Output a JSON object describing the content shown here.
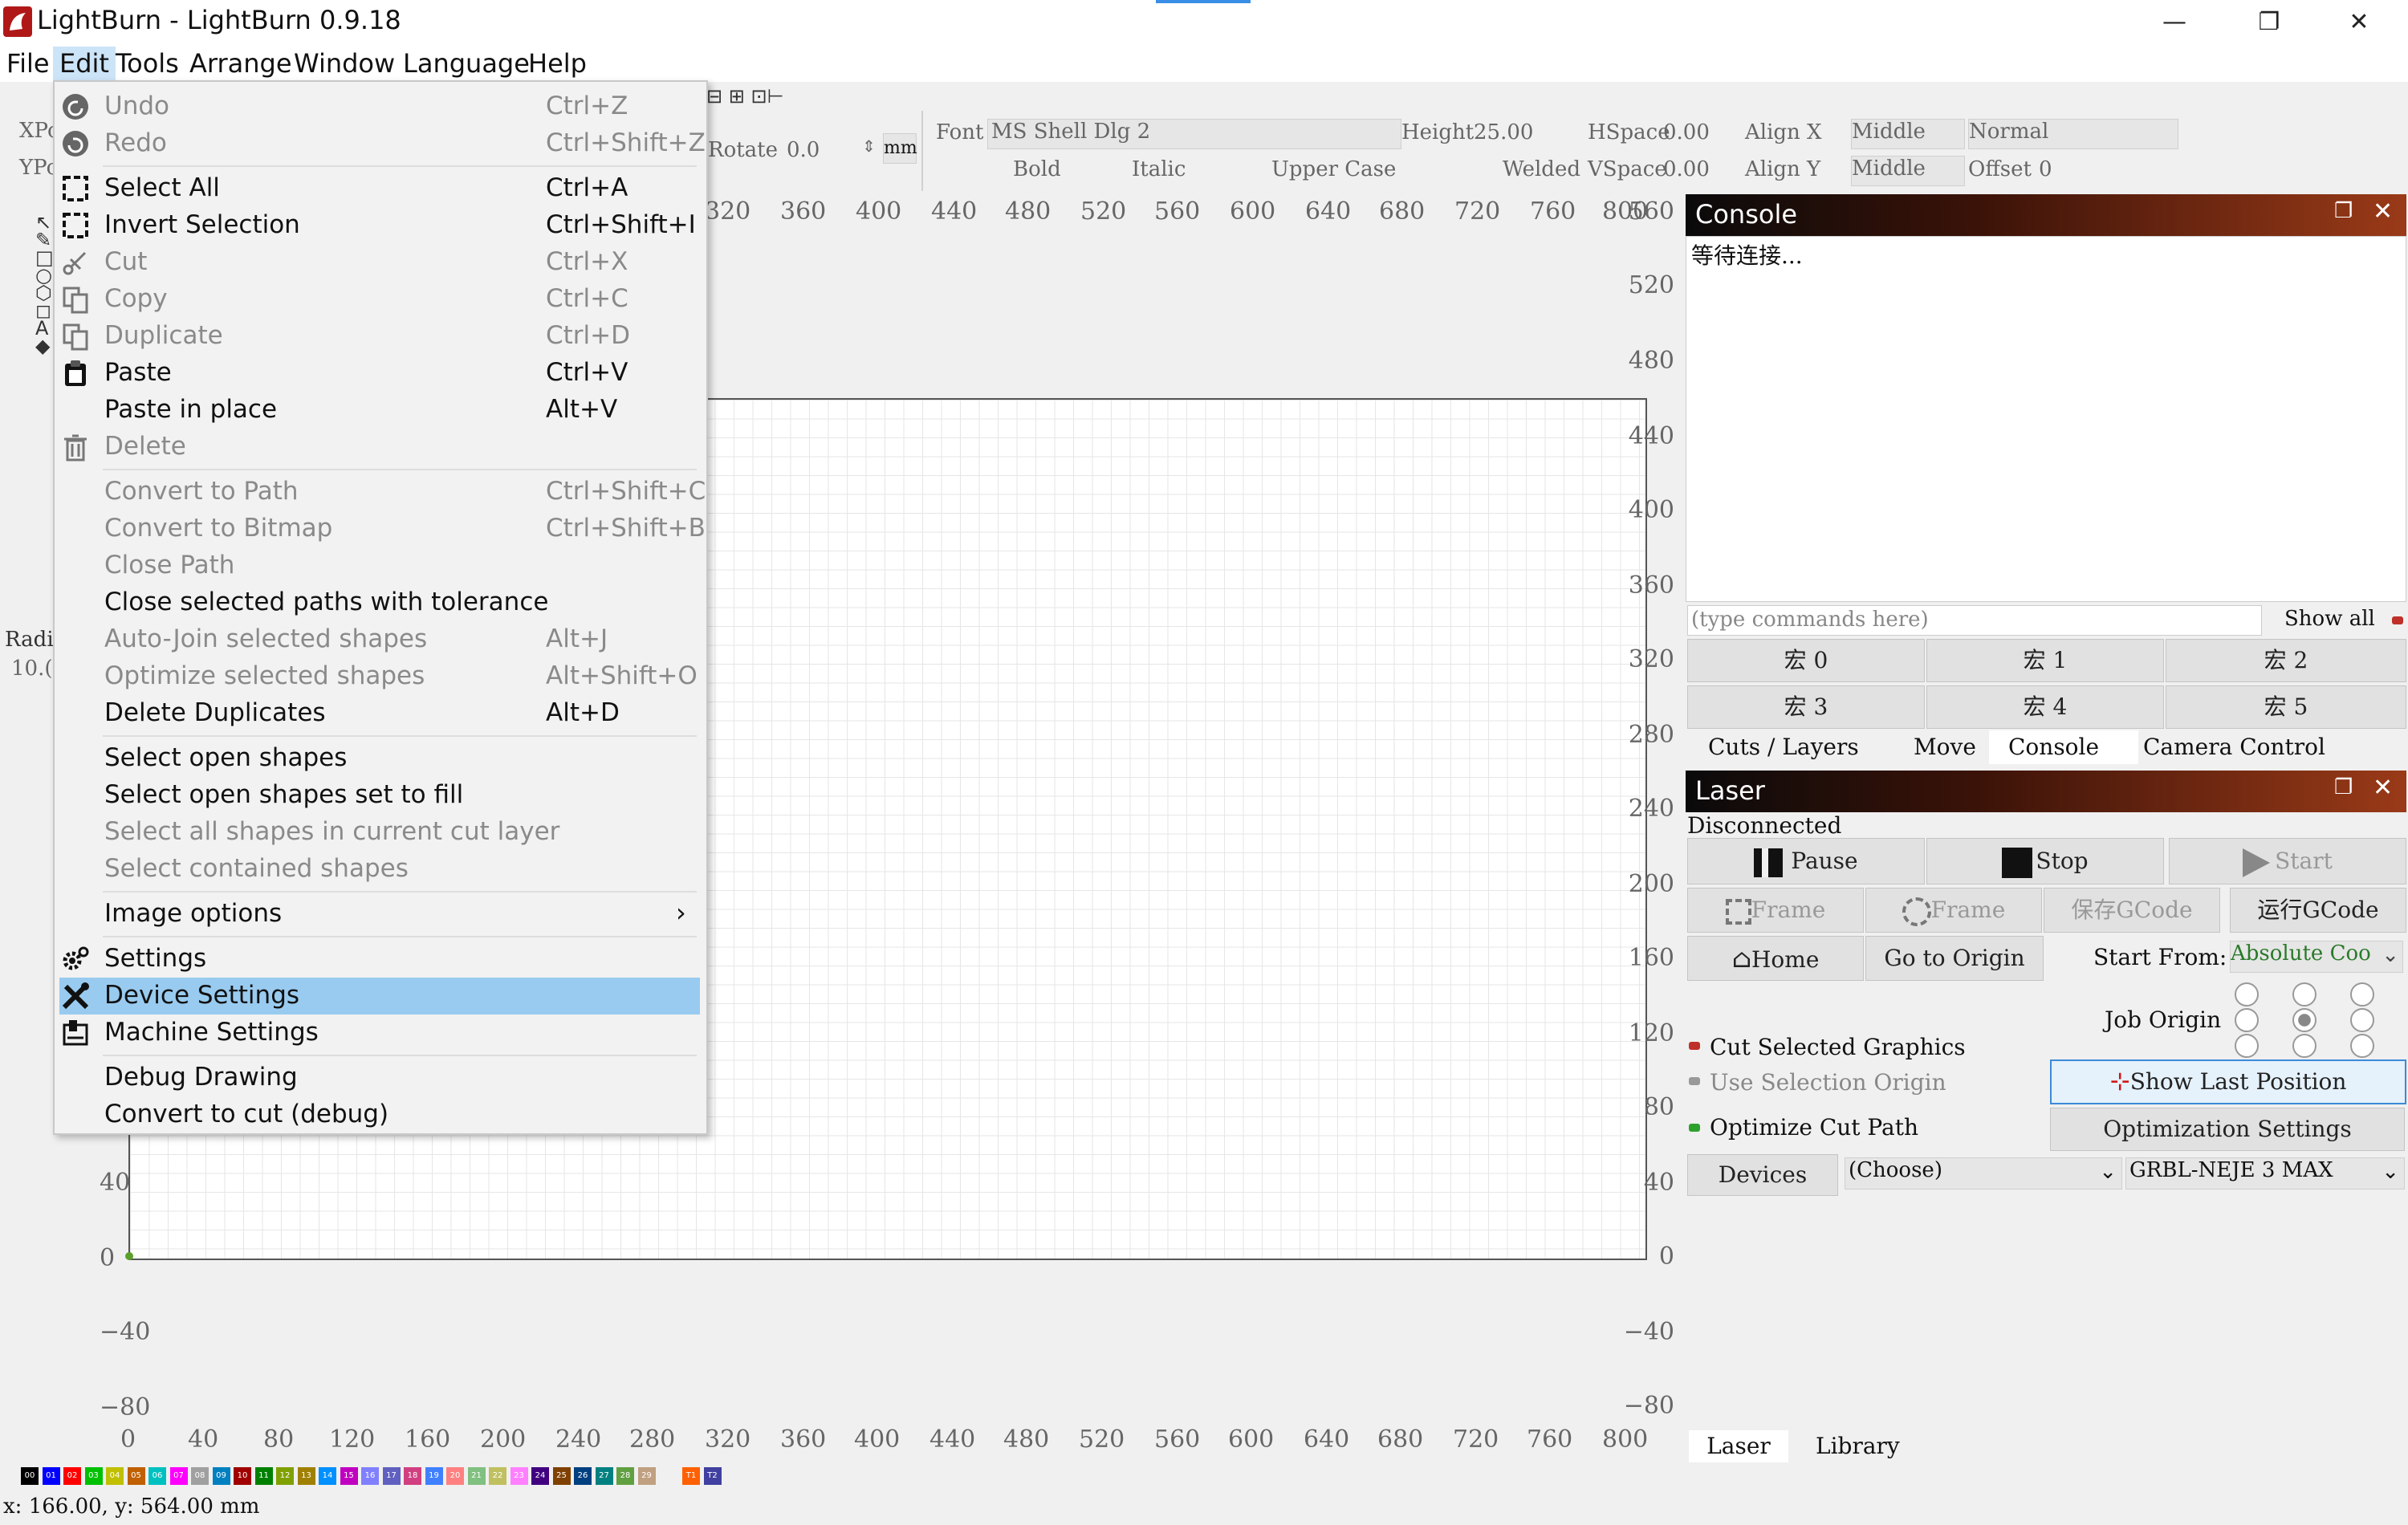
{
  "window": {
    "title": "LightBurn - LightBurn 0.9.18",
    "minimize": "—",
    "maximize": "❐",
    "close": "✕"
  },
  "menubar": [
    "File",
    "Edit",
    "Tools",
    "Arrange",
    "Window",
    "Language",
    "Help"
  ],
  "edit_menu": [
    {
      "label": "Undo",
      "shortcut": "Ctrl+Z",
      "disabled": true,
      "icon": "undo-icon"
    },
    {
      "label": "Redo",
      "shortcut": "Ctrl+Shift+Z",
      "disabled": true,
      "icon": "redo-icon"
    },
    {
      "label": "Select All",
      "shortcut": "Ctrl+A",
      "disabled": false,
      "icon": "select-all-icon"
    },
    {
      "label": "Invert Selection",
      "shortcut": "Ctrl+Shift+I",
      "disabled": false,
      "icon": "invert-selection-icon"
    },
    {
      "label": "Cut",
      "shortcut": "Ctrl+X",
      "disabled": true,
      "icon": "scissors-icon"
    },
    {
      "label": "Copy",
      "shortcut": "Ctrl+C",
      "disabled": true,
      "icon": "copy-icon"
    },
    {
      "label": "Duplicate",
      "shortcut": "Ctrl+D",
      "disabled": true,
      "icon": "duplicate-icon"
    },
    {
      "label": "Paste",
      "shortcut": "Ctrl+V",
      "disabled": false,
      "icon": "clipboard-icon"
    },
    {
      "label": "Paste in place",
      "shortcut": "Alt+V",
      "disabled": false,
      "icon": ""
    },
    {
      "label": "Delete",
      "shortcut": "",
      "disabled": true,
      "icon": "trash-icon"
    },
    {
      "label": "Convert to Path",
      "shortcut": "Ctrl+Shift+C",
      "disabled": true,
      "icon": ""
    },
    {
      "label": "Convert to Bitmap",
      "shortcut": "Ctrl+Shift+B",
      "disabled": true,
      "icon": ""
    },
    {
      "label": "Close Path",
      "shortcut": "",
      "disabled": true,
      "icon": ""
    },
    {
      "label": "Close selected paths with tolerance",
      "shortcut": "",
      "disabled": false,
      "icon": ""
    },
    {
      "label": "Auto-Join selected shapes",
      "shortcut": "Alt+J",
      "disabled": true,
      "icon": ""
    },
    {
      "label": "Optimize selected shapes",
      "shortcut": "Alt+Shift+O",
      "disabled": true,
      "icon": ""
    },
    {
      "label": "Delete Duplicates",
      "shortcut": "Alt+D",
      "disabled": false,
      "icon": ""
    },
    {
      "label": "Select open shapes",
      "shortcut": "",
      "disabled": false,
      "icon": ""
    },
    {
      "label": "Select open shapes set to fill",
      "shortcut": "",
      "disabled": false,
      "icon": ""
    },
    {
      "label": "Select all shapes in current cut layer",
      "shortcut": "",
      "disabled": true,
      "icon": ""
    },
    {
      "label": "Select contained shapes",
      "shortcut": "",
      "disabled": true,
      "icon": ""
    },
    {
      "label": "Image options",
      "shortcut": "",
      "disabled": false,
      "icon": "",
      "submenu": "›"
    },
    {
      "label": "Settings",
      "shortcut": "",
      "disabled": false,
      "icon": "gear-icon"
    },
    {
      "label": "Device Settings",
      "shortcut": "",
      "disabled": false,
      "icon": "tools-icon",
      "highlighted": true
    },
    {
      "label": "Machine Settings",
      "shortcut": "",
      "disabled": false,
      "icon": "machine-icon"
    },
    {
      "label": "Debug Drawing",
      "shortcut": "",
      "disabled": false,
      "icon": ""
    },
    {
      "label": "Convert to cut (debug)",
      "shortcut": "",
      "disabled": false,
      "icon": ""
    }
  ],
  "toolbar": {
    "xpos_label": "XPo",
    "ypos_label": "YPo",
    "rotate_label": "Rotate",
    "rotate_value": "0.0",
    "unit": "mm",
    "font_label": "Font",
    "font_value": "MS Shell Dlg 2",
    "height_label": "Height",
    "height_value": "25.00",
    "hspace_label": "HSpace",
    "hspace_value": "0.00",
    "vspace_label": "VSpace",
    "vspace_value": "0.00",
    "alignx_label": "Align X",
    "alignx_value": "Middle",
    "aligny_label": "Align Y",
    "aligny_value": "Middle",
    "normal_value": "Normal",
    "offset_label": "Offset",
    "offset_value": "0",
    "bold": "Bold",
    "italic": "Italic",
    "upper_case": "Upper Case",
    "welded": "Welded",
    "radius_label": "Radi",
    "radius_value": "10.("
  },
  "ruler": {
    "top_labels": [
      "320",
      "360",
      "400",
      "440",
      "480",
      "520",
      "560",
      "600",
      "640",
      "680",
      "720",
      "760",
      "800"
    ],
    "bottom_labels": [
      "0",
      "40",
      "80",
      "120",
      "160",
      "200",
      "240",
      "280",
      "320",
      "360",
      "400",
      "440",
      "480",
      "520",
      "560",
      "600",
      "640",
      "680",
      "720",
      "760",
      "800"
    ],
    "right_labels": [
      "560",
      "520",
      "480",
      "440",
      "400",
      "360",
      "320",
      "280",
      "240",
      "200",
      "160",
      "120",
      "80",
      "40",
      "0",
      "−40",
      "−80"
    ],
    "left_labels": [
      "40",
      "0",
      "−40",
      "−80"
    ]
  },
  "console": {
    "title": "Console",
    "output": "等待连接...",
    "input_placeholder": "(type commands here)",
    "show_all": "Show all",
    "macros": [
      "宏 0",
      "宏 1",
      "宏 2",
      "宏 3",
      "宏 4",
      "宏 5"
    ],
    "tabs": [
      "Cuts / Layers",
      "Move",
      "Console",
      "Camera Control"
    ]
  },
  "laser": {
    "title": "Laser",
    "status": "Disconnected",
    "pause": "Pause",
    "stop": "Stop",
    "start": "Start",
    "frame1": "Frame",
    "frame2": "Frame",
    "save_gcode": "保存GCode",
    "run_gcode": "运行GCode",
    "home": "Home",
    "go_origin": "Go to Origin",
    "start_from_label": "Start From:",
    "start_from_value": "Absolute Coo",
    "job_origin": "Job Origin",
    "cut_selected": "Cut Selected Graphics",
    "use_selection_origin": "Use Selection Origin",
    "show_last_position": "Show Last Position",
    "optimize_cut_path": "Optimize Cut Path",
    "optimization_settings": "Optimization Settings",
    "devices": "Devices",
    "choose": "(Choose)",
    "device_name": "GRBL-NEJE 3 MAX",
    "bottom_tabs": [
      "Laser",
      "Library"
    ]
  },
  "palette": [
    "00",
    "01",
    "02",
    "03",
    "04",
    "05",
    "06",
    "07",
    "08",
    "09",
    "10",
    "11",
    "12",
    "13",
    "14",
    "15",
    "16",
    "17",
    "18",
    "19",
    "20",
    "21",
    "22",
    "23",
    "24",
    "25",
    "26",
    "27",
    "28",
    "29",
    "T1",
    "T2"
  ],
  "palette_colors": [
    "#000000",
    "#0000ff",
    "#ff0000",
    "#00c000",
    "#c0c000",
    "#c06000",
    "#00c0c0",
    "#ff00ff",
    "#a0a0a0",
    "#0080c0",
    "#a00000",
    "#008000",
    "#80a000",
    "#a08000",
    "#0090ff",
    "#c000c0",
    "#8080ff",
    "#6060c0",
    "#d04080",
    "#4080ff",
    "#ff8080",
    "#80c080",
    "#c0c060",
    "#ff80ff",
    "#400080",
    "#804000",
    "#004080",
    "#008080",
    "#60a040",
    "#c0a080",
    "#ff6000",
    "#4040a0"
  ],
  "status": {
    "coords": "x: 166.00, y: 564.00 mm"
  }
}
